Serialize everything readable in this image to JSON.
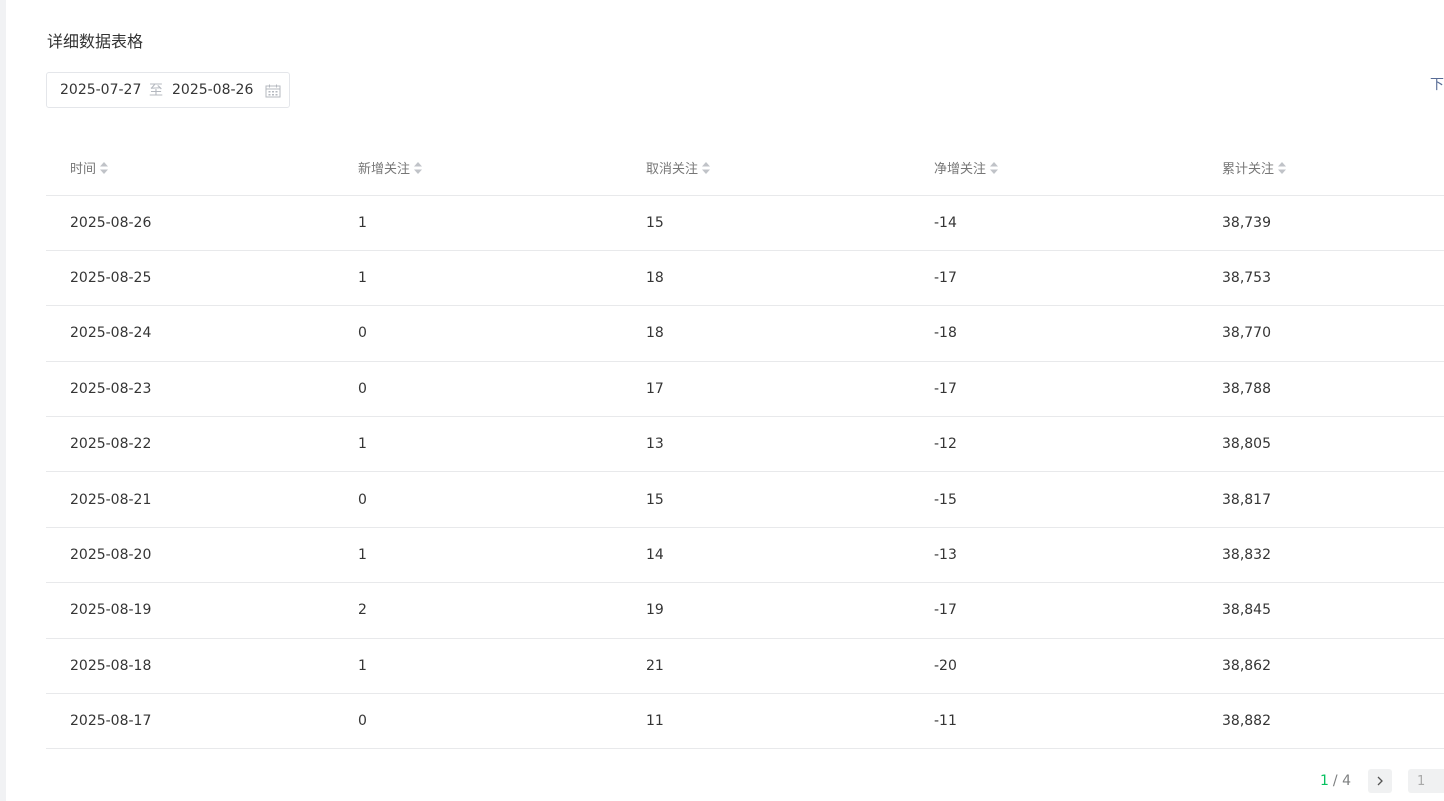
{
  "page": {
    "title": "详细数据表格",
    "download_label": "下载数据明细"
  },
  "date_range": {
    "start": "2025-07-27",
    "separator": "至",
    "end": "2025-08-26"
  },
  "table": {
    "columns": [
      "时间",
      "新增关注",
      "取消关注",
      "净增关注",
      "累计关注"
    ],
    "rows": [
      [
        "2025-08-26",
        "1",
        "15",
        "-14",
        "38,739"
      ],
      [
        "2025-08-25",
        "1",
        "18",
        "-17",
        "38,753"
      ],
      [
        "2025-08-24",
        "0",
        "18",
        "-18",
        "38,770"
      ],
      [
        "2025-08-23",
        "0",
        "17",
        "-17",
        "38,788"
      ],
      [
        "2025-08-22",
        "1",
        "13",
        "-12",
        "38,805"
      ],
      [
        "2025-08-21",
        "0",
        "15",
        "-15",
        "38,817"
      ],
      [
        "2025-08-20",
        "1",
        "14",
        "-13",
        "38,832"
      ],
      [
        "2025-08-19",
        "2",
        "19",
        "-17",
        "38,845"
      ],
      [
        "2025-08-18",
        "1",
        "21",
        "-20",
        "38,862"
      ],
      [
        "2025-08-17",
        "0",
        "11",
        "-11",
        "38,882"
      ]
    ]
  },
  "pagination": {
    "current": "1",
    "total": "/ 4",
    "jump_value": "1"
  },
  "icons": {
    "calendar": "calendar-icon",
    "sort": "sort-icon",
    "next": "chevron-right-icon"
  },
  "colors": {
    "accent": "#07c160",
    "link": "#576b95",
    "text": "#353535",
    "header_text": "#777777",
    "border": "#e8e9eb"
  }
}
